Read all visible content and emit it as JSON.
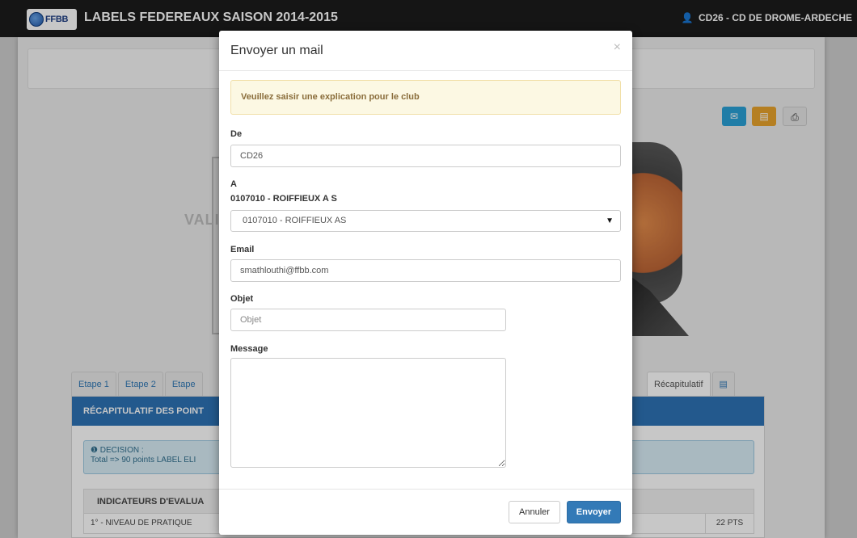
{
  "navbar": {
    "logo_text": "FFBB",
    "title": "LABELS FEDEREAUX SAISON 2014-2015",
    "user_label": "CD26 - CD DE DROME-ARDECHE"
  },
  "background": {
    "card_text": "VALI",
    "tabs_left": [
      "Etape 1",
      "Etape 2",
      "Etape"
    ],
    "tabs_right": [
      "Récapitulatif"
    ],
    "panel_title": "RÉCAPITULATIF DES POINT",
    "decision_title": "DECISION :",
    "decision_text": "Total => 90 points LABEL ELI",
    "table_header": "INDICATEURS D'EVALUA",
    "row1_label": "1° - NIVEAU DE PRATIQUE",
    "row1_points": "22 PTS"
  },
  "modal": {
    "title": "Envoyer un mail",
    "close": "×",
    "alert": "Veuillez saisir une explication pour le club",
    "from_label": "De",
    "from_value": "CD26",
    "to_label": "A",
    "to_club": "0107010 - ROIFFIEUX A S",
    "to_select_value": "0107010 - ROIFFIEUX AS",
    "email_label": "Email",
    "email_value": "smathlouthi@ffbb.com",
    "subject_label": "Objet",
    "subject_placeholder": "Objet",
    "message_label": "Message",
    "cancel_label": "Annuler",
    "send_label": "Envoyer"
  },
  "colors": {
    "primary": "#337ab7",
    "panel_blue": "#2d73b5",
    "alert_bg": "#fcf8e3",
    "alert_text": "#8a6d3b",
    "mail_btn": "#2aa0d6",
    "folder_btn": "#e8a32c"
  }
}
